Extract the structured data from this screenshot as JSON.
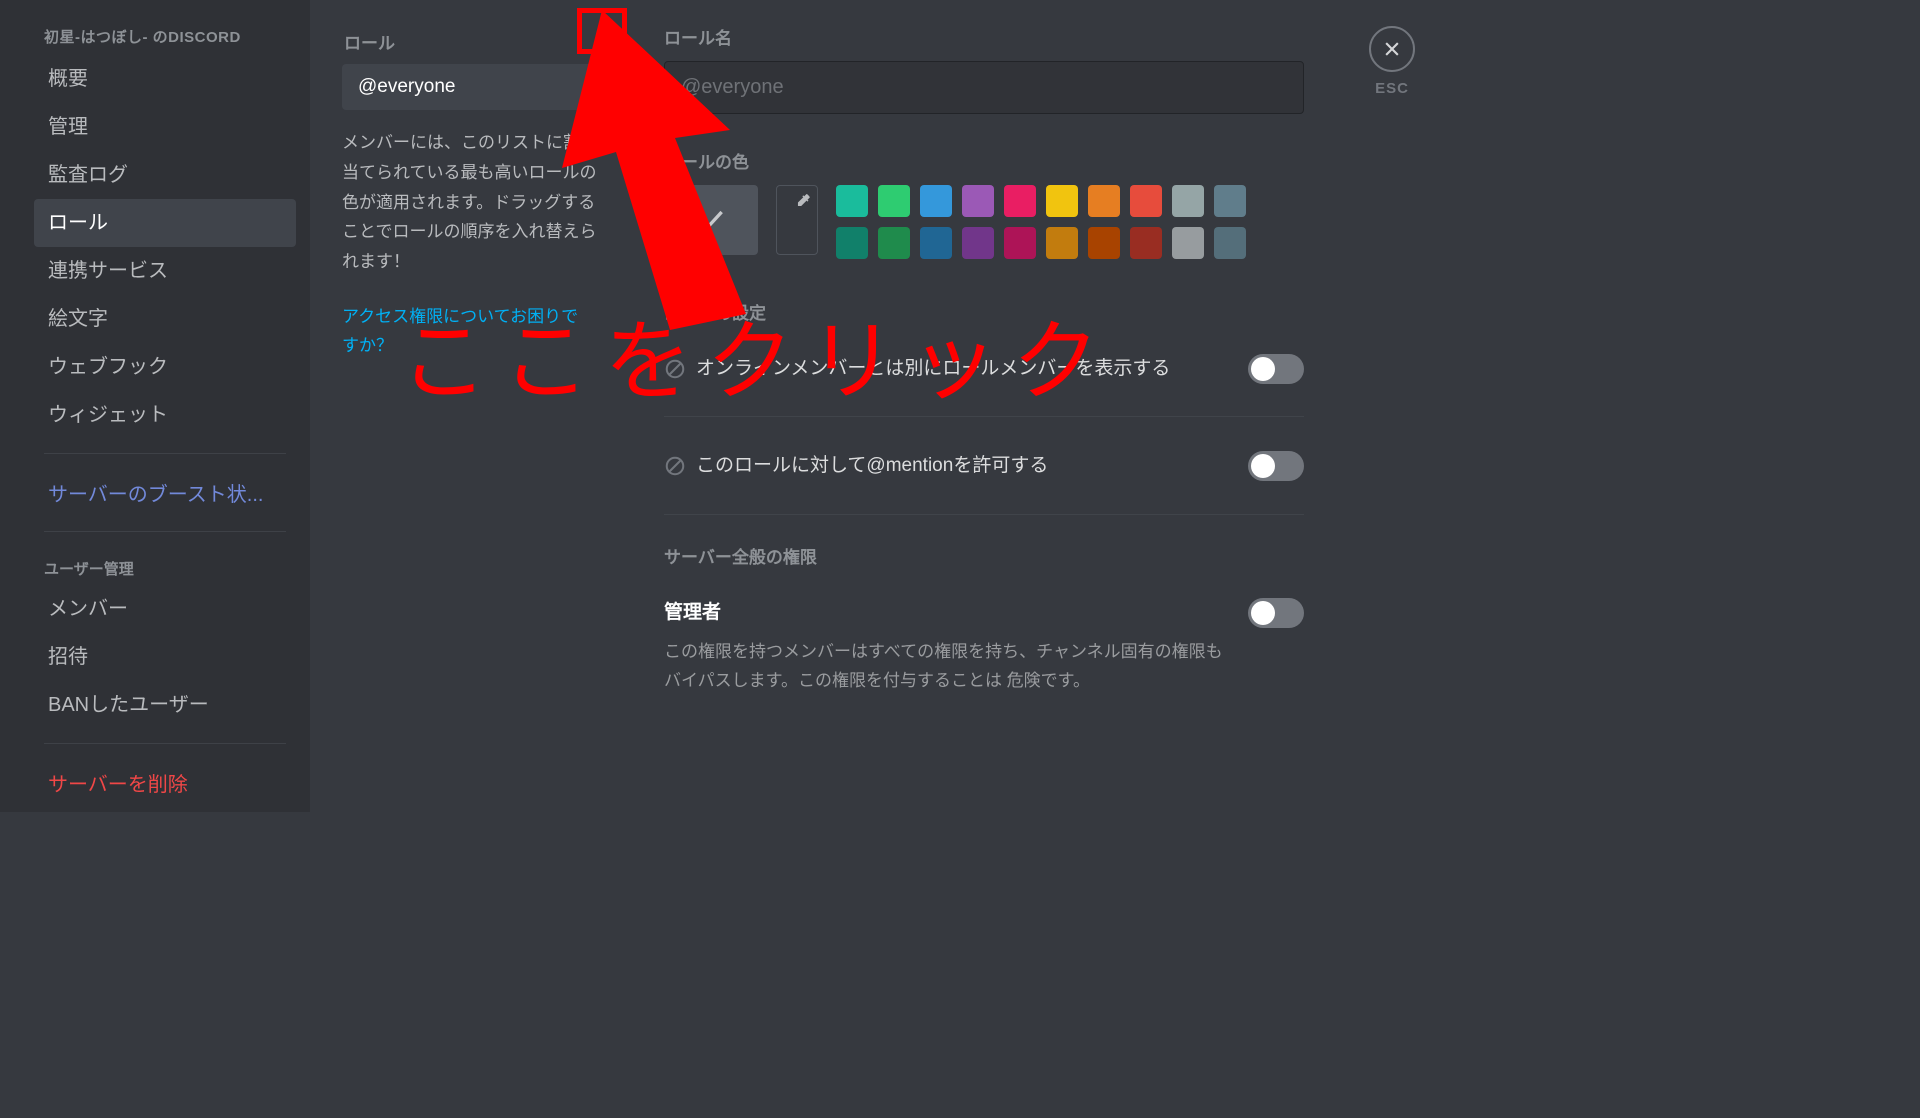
{
  "sidebar": {
    "server_name": "初星-はつぼし- のDISCORD",
    "items": [
      {
        "label": "概要"
      },
      {
        "label": "管理"
      },
      {
        "label": "監査ログ"
      },
      {
        "label": "ロール"
      },
      {
        "label": "連携サービス"
      },
      {
        "label": "絵文字"
      },
      {
        "label": "ウェブフック"
      },
      {
        "label": "ウィジェット"
      }
    ],
    "boost_link": "サーバーのブースト状...",
    "user_mgmt_header": "ユーザー管理",
    "user_mgmt": [
      {
        "label": "メンバー"
      },
      {
        "label": "招待"
      },
      {
        "label": "BANしたユーザー"
      }
    ],
    "delete_link": "サーバーを削除"
  },
  "role_list": {
    "header": "ロール",
    "entry": "@everyone",
    "note": "メンバーには、このリストに割り当てられている最も高いロールの色が適用されます。ドラッグすることでロールの順序を入れ替えられます！",
    "help": "アクセス権限についてお困りですか？"
  },
  "role_detail": {
    "name_label": "ロール名",
    "name_placeholder": "@everyone",
    "color_label": "ロールの色",
    "settings_header": "ロールの設定",
    "perm_display_separately": "オンラインメンバーとは別にロールメンバーを表示する",
    "perm_allow_mention": "このロールに対して@mentionを許可する",
    "server_perm_header": "サーバー全般の権限",
    "admin_title": "管理者",
    "admin_desc": "この権限を持つメンバーはすべての権限を持ち、チャンネル固有の権限もバイパスします。この権限を付与することは 危険です。"
  },
  "colors": {
    "row1": [
      "#1abc9c",
      "#2ecc71",
      "#3498db",
      "#9b59b6",
      "#e91e63",
      "#f1c40f",
      "#e67e22",
      "#e74c3c",
      "#95a5a6",
      "#607d8b"
    ],
    "row2": [
      "#11806a",
      "#1f8b4c",
      "#206694",
      "#71368a",
      "#ad1457",
      "#c27c0e",
      "#a84300",
      "#992d22",
      "#979c9f",
      "#546e7a"
    ]
  },
  "close": {
    "esc": "ESC"
  },
  "annotation": {
    "text": "ここをクリック"
  }
}
